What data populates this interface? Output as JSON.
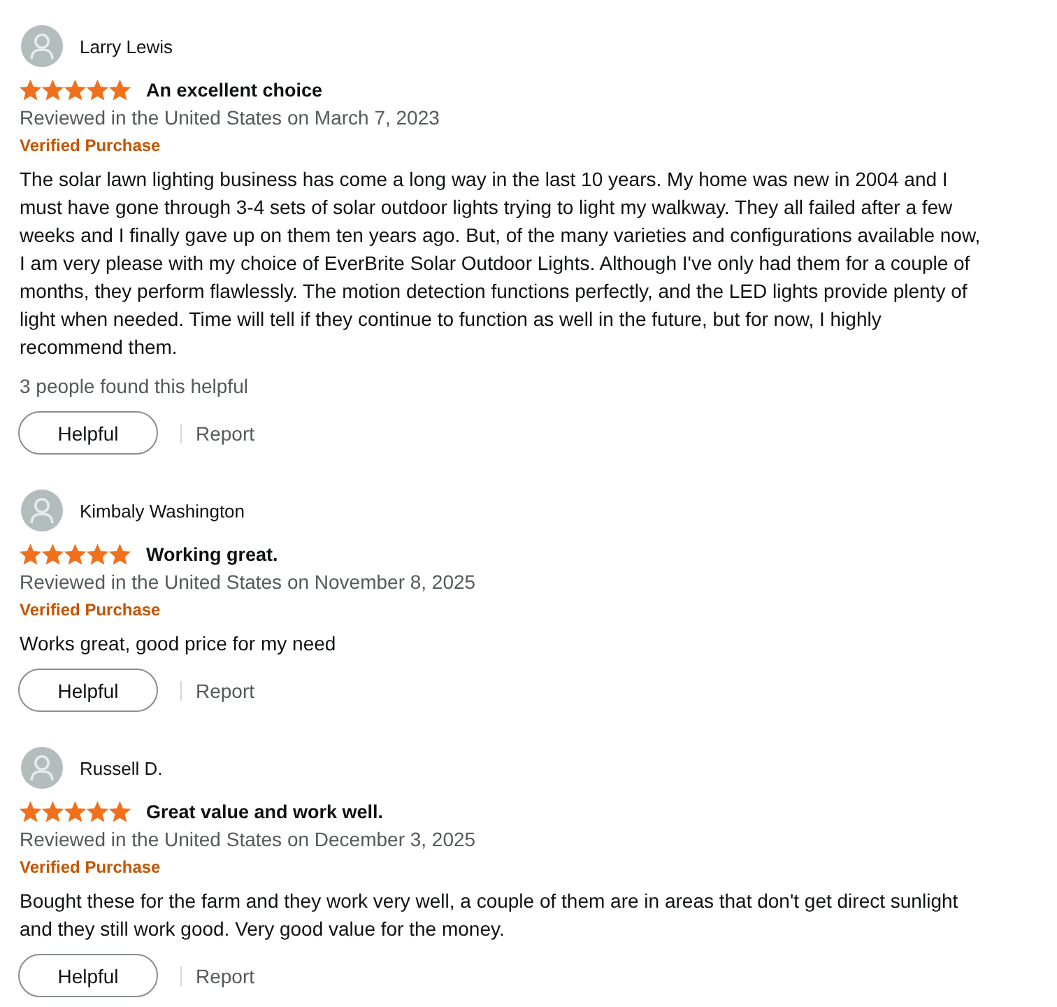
{
  "reviews": [
    {
      "reviewer": "Larry Lewis",
      "stars": 5,
      "title": "An excellent choice",
      "date": "Reviewed in the United States on March 7, 2023",
      "verified": "Verified Purchase",
      "body": "The solar lawn lighting business has come a long way in the last 10 years. My home was new in 2004 and I must have gone through 3-4 sets of solar outdoor lights trying to light my walkway. They all failed after a few weeks and I finally gave up on them ten years ago. But, of the many varieties and configurations available now, I am very please with my choice of EverBrite Solar Outdoor Lights. Although I've only had them for a couple of months, they perform flawlessly. The motion detection functions perfectly, and the LED lights provide plenty of light when needed. Time will tell if they continue to function as well in the future, but for now, I highly recommend them.",
      "helpful_count": "3 people found this helpful",
      "helpful_button": "Helpful",
      "report_link": "Report"
    },
    {
      "reviewer": "Kimbaly Washington",
      "stars": 5,
      "title": "Working great.",
      "date": "Reviewed in the United States on November 8, 2025",
      "verified": "Verified Purchase",
      "body": "Works great, good price for my need",
      "helpful_button": "Helpful",
      "report_link": "Report"
    },
    {
      "reviewer": "Russell D.",
      "stars": 5,
      "title": "Great value and work well.",
      "date": "Reviewed in the United States on December 3, 2025",
      "verified": "Verified Purchase",
      "body": "Bought these for the farm and they work very well, a couple of them are in areas that don't get direct sunlight and they still work good. Very good value for the money.",
      "helpful_button": "Helpful",
      "report_link": "Report"
    }
  ]
}
